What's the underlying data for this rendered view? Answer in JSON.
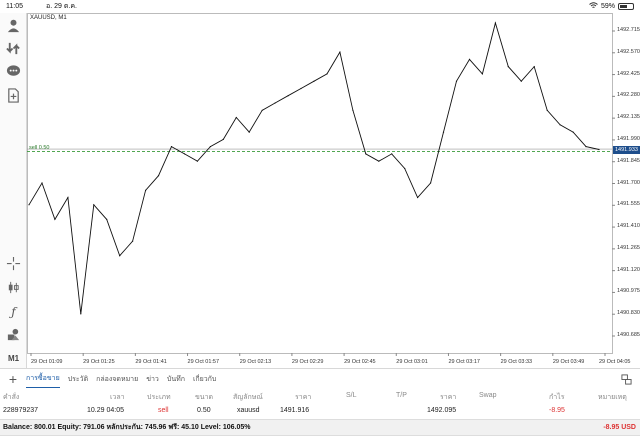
{
  "status_bar": {
    "time": "11:05",
    "date": "อ. 29 ต.ค.",
    "battery": "59%",
    "battery_level": 0.59
  },
  "chart": {
    "symbol": "XAUUSD, M1",
    "sell_label": "sell 0.50",
    "current_price": "1491.933",
    "price_ticks": [
      "1492.715",
      "1492.570",
      "1492.425",
      "1492.280",
      "1492.135",
      "1491.990",
      "1491.845",
      "1491.700",
      "1491.555",
      "1491.410",
      "1491.265",
      "1491.120",
      "1490.975",
      "1490.830",
      "1490.685"
    ],
    "time_ticks": [
      "29 Oct 01:09",
      "29 Oct 01:25",
      "29 Oct 01:41",
      "29 Oct 01:57",
      "29 Oct 02:13",
      "29 Oct 02:29",
      "29 Oct 02:45",
      "29 Oct 03:01",
      "29 Oct 03:17",
      "29 Oct 03:33",
      "29 Oct 03:49",
      "29 Oct 04:05"
    ]
  },
  "chart_data": {
    "type": "line",
    "title": "XAUUSD, M1",
    "ylim": [
      1490.6,
      1492.8
    ],
    "x": [
      "01:09",
      "01:13",
      "01:17",
      "01:21",
      "01:25",
      "01:29",
      "01:33",
      "01:37",
      "01:41",
      "01:45",
      "01:49",
      "01:53",
      "01:57",
      "02:01",
      "02:05",
      "02:09",
      "02:13",
      "02:17",
      "02:21",
      "02:25",
      "02:29",
      "02:33",
      "02:37",
      "02:41",
      "02:45",
      "02:49",
      "02:53",
      "02:57",
      "03:01",
      "03:05",
      "03:09",
      "03:13",
      "03:17",
      "03:21",
      "03:25",
      "03:29",
      "03:33",
      "03:37",
      "03:41",
      "03:45",
      "03:49",
      "03:53",
      "03:57",
      "04:01",
      "04:05"
    ],
    "series": [
      {
        "values": [
          1491.55,
          1491.7,
          1491.45,
          1491.6,
          1490.8,
          1491.55,
          1491.45,
          1491.2,
          1491.3,
          1491.65,
          1491.75,
          1491.95,
          1491.9,
          1491.85,
          1491.95,
          1492.0,
          1492.15,
          1492.05,
          1492.2,
          1492.25,
          1492.3,
          1492.35,
          1492.4,
          1492.45,
          1492.6,
          1492.2,
          1491.9,
          1491.85,
          1491.9,
          1491.8,
          1491.6,
          1491.7,
          1492.05,
          1492.4,
          1492.55,
          1492.45,
          1492.8,
          1492.5,
          1492.4,
          1492.5,
          1492.2,
          1492.1,
          1492.05,
          1491.95,
          1491.93
        ]
      }
    ]
  },
  "tabs": {
    "items": [
      "การซื้อขาย",
      "ประวัติ",
      "กล่องจดหมาย",
      "ข่าว",
      "บันทึก",
      "เกี่ยวกับ"
    ]
  },
  "table": {
    "headers": [
      "คำสั่ง",
      "เวลา",
      "ประเภท",
      "ขนาด",
      "สัญลักษณ์",
      "ราคา",
      "S/L",
      "T/P",
      "ราคา",
      "Swap",
      "กำไร",
      "หมายเหตุ"
    ],
    "row": {
      "order": "228979237",
      "time": "10.29 04:05",
      "type": "sell",
      "size": "0.50",
      "symbol": "xauusd",
      "price": "1491.916",
      "sl": "",
      "tp": "",
      "cur_price": "1492.095",
      "swap": "",
      "profit": "-8.95",
      "note": ""
    }
  },
  "balance": {
    "text": "Balance: 800.01  Equity: 791.06  หลักประกัน: 745.96  ฟรี: 45.10  Level: 106.05%",
    "total": "-8.95  USD"
  },
  "toolbar": {
    "timeframe": "M1"
  }
}
